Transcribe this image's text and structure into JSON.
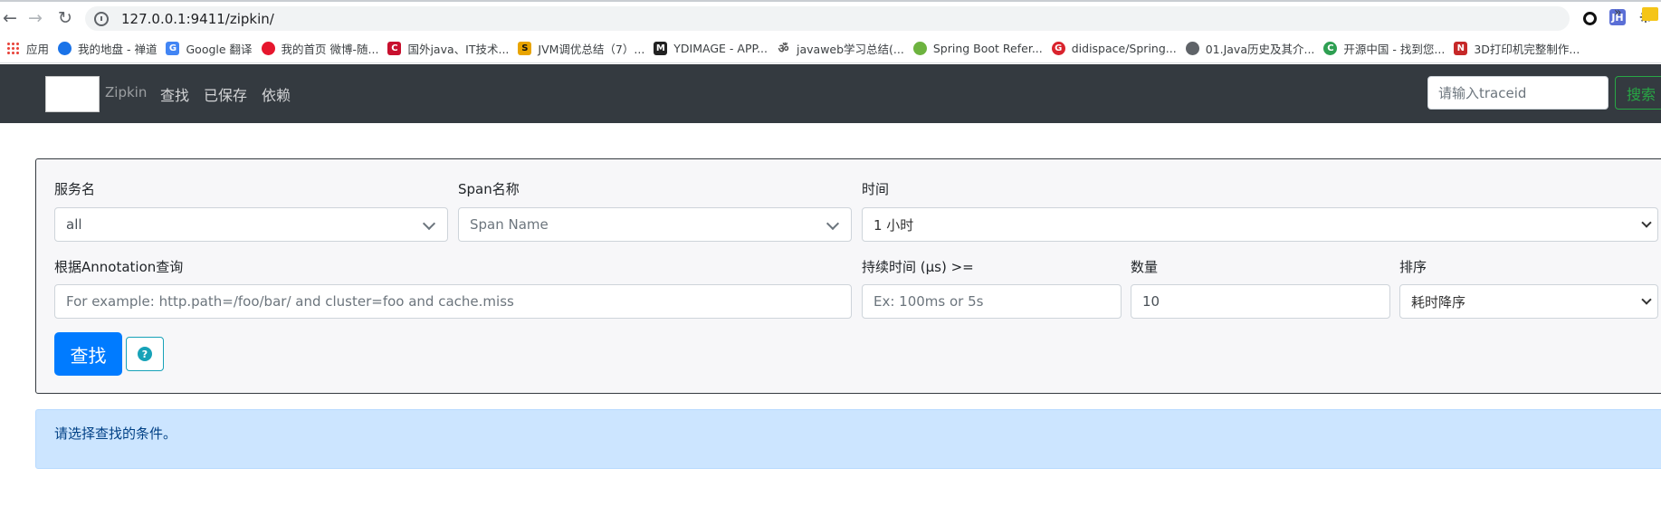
{
  "browser": {
    "url": "127.0.0.1:9411/zipkin/",
    "extensions": [
      "JH"
    ],
    "bookmarks": [
      {
        "label": "应用",
        "icon": "apps-grid-icon",
        "color": "#e8453c"
      },
      {
        "label": "我的地盘 - 禅道",
        "icon": "globe-icon",
        "color": "#1a73e8"
      },
      {
        "label": "Google 翻译",
        "icon": "google-translate-icon",
        "color": "#4285f4"
      },
      {
        "label": "我的首页 微博-随...",
        "icon": "weibo-icon",
        "color": "#e6162d"
      },
      {
        "label": "国外java、IT技术...",
        "icon": "c-logo-icon",
        "color": "#c8102e"
      },
      {
        "label": "JVM调优总结（7）...",
        "icon": "s-logo-icon",
        "color": "#e8a400"
      },
      {
        "label": "YDIMAGE - APP...",
        "icon": "m-logo-icon",
        "color": "#222222"
      },
      {
        "label": "javaweb学习总结(...",
        "icon": "feather-icon",
        "color": "#555555"
      },
      {
        "label": "Spring Boot Refer...",
        "icon": "spring-leaf-icon",
        "color": "#6db33f"
      },
      {
        "label": "didispace/Spring...",
        "icon": "g-logo-icon",
        "color": "#d9232d"
      },
      {
        "label": "01.Java历史及其介...",
        "icon": "globe-icon",
        "color": "#5f6368"
      },
      {
        "label": "开源中国 - 找到您...",
        "icon": "oschina-icon",
        "color": "#2e9f52"
      },
      {
        "label": "3D打印机完整制作...",
        "icon": "n-logo-icon",
        "color": "#c62828"
      }
    ],
    "more": "»"
  },
  "navbar": {
    "brand": "Zipkin",
    "links": [
      "查找",
      "已保存",
      "依赖"
    ],
    "trace_placeholder": "请输入traceid",
    "search_label": "搜索"
  },
  "form": {
    "service": {
      "label": "服务名",
      "value": "all"
    },
    "span": {
      "label": "Span名称",
      "placeholder": "Span Name"
    },
    "time": {
      "label": "时间",
      "value": "1 小时"
    },
    "annotation": {
      "label": "根据Annotation查询",
      "placeholder": "For example: http.path=/foo/bar/ and cluster=foo and cache.miss"
    },
    "duration": {
      "label": "持续时间 (μs) >=",
      "placeholder": "Ex: 100ms or 5s"
    },
    "limit": {
      "label": "数量",
      "value": "10"
    },
    "sort": {
      "label": "排序",
      "value": "耗时降序"
    },
    "find_label": "查找",
    "help_glyph": "?"
  },
  "alert": {
    "text": "请选择查找的条件。"
  },
  "colors": {
    "navbar": "#343a40",
    "primary": "#007bff",
    "success": "#28a745",
    "info": "#17a2b8",
    "alert_bg": "#cce5ff"
  }
}
